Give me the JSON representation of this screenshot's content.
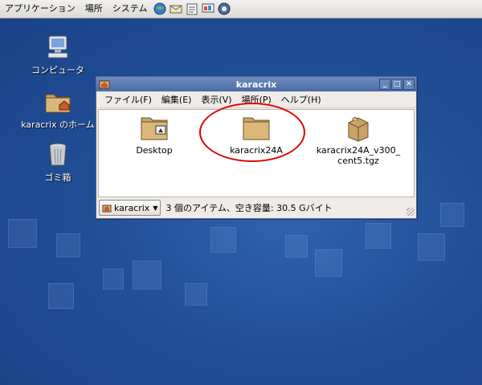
{
  "top_panel": {
    "menus": [
      "アプリケーション",
      "場所",
      "システム"
    ],
    "launchers": [
      "web-browser-icon",
      "email-icon",
      "notes-icon",
      "presentation-icon",
      "help-icon"
    ]
  },
  "desktop": {
    "icons": [
      {
        "label": "コンピュータ",
        "icon": "computer-icon"
      },
      {
        "label": "karacrix のホーム",
        "icon": "home-folder-icon"
      },
      {
        "label": "ゴミ箱",
        "icon": "trash-icon"
      }
    ]
  },
  "window": {
    "title": "karacrix",
    "menus": [
      "ファイル(F)",
      "編集(E)",
      "表示(V)",
      "場所(P)",
      "ヘルプ(H)"
    ],
    "files": [
      {
        "name": "Desktop",
        "icon": "desktop-folder-icon"
      },
      {
        "name": "karacrix24A",
        "icon": "folder-icon"
      },
      {
        "name": "karacrix24A_v300_cent5.tgz",
        "icon": "archive-icon"
      }
    ],
    "status": {
      "location": "karacrix",
      "text": "3 個のアイテム、空き容量: 30.5 Gバイト"
    }
  },
  "colors": {
    "desktop_bg": "#1e4a8f",
    "titlebar": "#4a6ca6",
    "annotation": "#e00000"
  }
}
